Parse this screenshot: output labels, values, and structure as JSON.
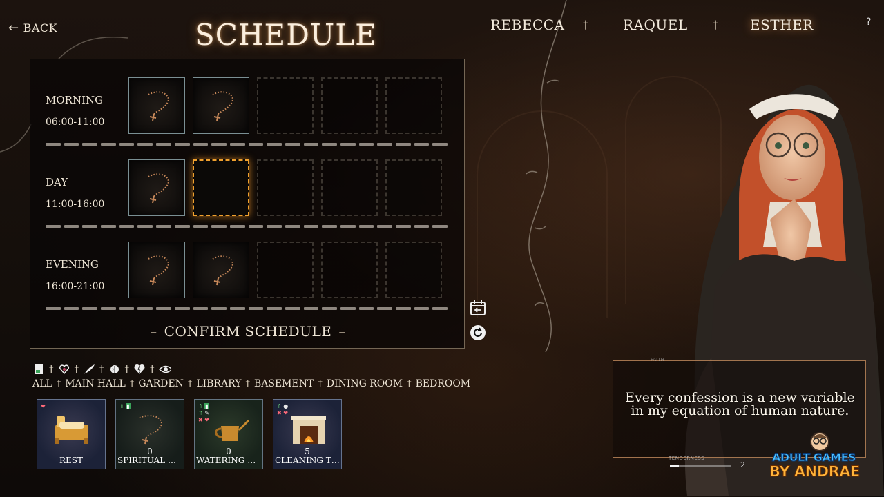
{
  "nav": {
    "back_label": "BACK"
  },
  "title": "SCHEDULE",
  "characters": [
    {
      "name": "REBECCA",
      "active": false
    },
    {
      "name": "RAQUEL",
      "active": false
    },
    {
      "name": "ESTHER",
      "active": true
    }
  ],
  "separator": "†",
  "help_label": "?",
  "schedule": {
    "rows": [
      {
        "name": "MORNING",
        "time": "06:00-11:00",
        "slots": [
          "rosary",
          "rosary",
          "empty",
          "empty",
          "empty"
        ]
      },
      {
        "name": "DAY",
        "time": "11:00-16:00",
        "slots": [
          "rosary",
          "selected",
          "empty",
          "empty",
          "empty"
        ]
      },
      {
        "name": "EVENING",
        "time": "16:00-21:00",
        "slots": [
          "rosary",
          "rosary",
          "empty",
          "empty",
          "empty"
        ]
      }
    ],
    "confirm_label": "CONFIRM SCHEDULE"
  },
  "side_buttons": [
    "calendar-back-icon",
    "reset-icon"
  ],
  "filter_icons": [
    "book-icon",
    "heart-icon",
    "quill-icon",
    "brain-icon",
    "broken-heart-icon",
    "eye-icon"
  ],
  "locations": [
    {
      "label": "ALL",
      "active": true
    },
    {
      "label": "MAIN HALL",
      "active": false
    },
    {
      "label": "GARDEN",
      "active": false
    },
    {
      "label": "LIBRARY",
      "active": false
    },
    {
      "label": "BASEMENT",
      "active": false
    },
    {
      "label": "DINING ROOM",
      "active": false
    },
    {
      "label": "BEDROOM",
      "active": false
    }
  ],
  "activities": [
    {
      "name": "REST",
      "count": "",
      "icon": "bed-icon",
      "bg": "#1c2238"
    },
    {
      "name": "SPIRITUAL GUI...",
      "count": "0",
      "icon": "rosary-icon",
      "bg": "#1a2420"
    },
    {
      "name": "WATERING PLA...",
      "count": "0",
      "icon": "watering-can-icon",
      "bg": "#1a2a20"
    },
    {
      "name": "CLEANING THE...",
      "count": "5",
      "icon": "fireplace-icon",
      "bg": "#1c2238"
    }
  ],
  "quote": "Every confession is a new variable in my equation of human nature.",
  "stats_ghost": {
    "faith_label": "FAITH"
  },
  "tenderness": {
    "label": "TENDERNESS",
    "value": "2",
    "level": 0.15
  },
  "watermark": {
    "line1": "ADULT GAMES",
    "line2": "BY ANDRAE"
  }
}
